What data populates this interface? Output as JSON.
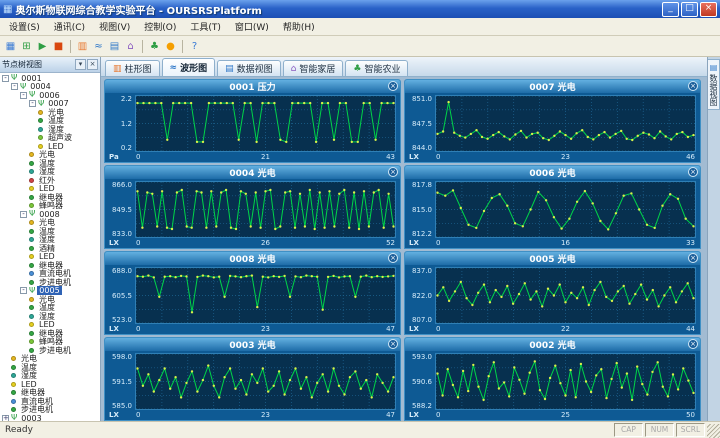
{
  "window": {
    "title": "奥尔斯物联网综合教学实验平台 - OURSRSPlatform",
    "icon": "▦",
    "buttons": {
      "min": "_",
      "max": "□",
      "close": "×"
    }
  },
  "menu": {
    "items": [
      {
        "name": "menu-settings",
        "label": "设置(S)"
      },
      {
        "name": "menu-comm",
        "label": "通讯(C)"
      },
      {
        "name": "menu-view",
        "label": "视图(V)"
      },
      {
        "name": "menu-control",
        "label": "控制(O)"
      },
      {
        "name": "menu-tools",
        "label": "工具(T)"
      },
      {
        "name": "menu-window",
        "label": "窗口(W)"
      },
      {
        "name": "menu-help",
        "label": "帮助(H)"
      }
    ]
  },
  "toolbar": {
    "icons": [
      {
        "name": "config-icon",
        "glyph": "▦",
        "color": "#3a7bd5"
      },
      {
        "name": "serial-connect-icon",
        "glyph": "⊞",
        "color": "#2f9e44"
      },
      {
        "name": "start-icon",
        "glyph": "▶",
        "color": "#2f9e44"
      },
      {
        "name": "stop-icon",
        "glyph": "■",
        "color": "#d9480f"
      },
      {
        "sep": true
      },
      {
        "name": "bar-chart-icon",
        "glyph": "▥",
        "color": "#e8762d"
      },
      {
        "name": "waveform-icon",
        "glyph": "≈",
        "color": "#2e77c8"
      },
      {
        "name": "data-table-icon",
        "glyph": "▤",
        "color": "#2e77c8"
      },
      {
        "name": "smart-home-icon",
        "glyph": "⌂",
        "color": "#8a5ac0"
      },
      {
        "sep": true
      },
      {
        "name": "smart-agriculture-icon",
        "glyph": "♣",
        "color": "#2f9e44"
      },
      {
        "name": "node-manager-icon",
        "glyph": "●",
        "color": "#f59f00"
      },
      {
        "sep": true
      },
      {
        "name": "help-icon",
        "glyph": "?",
        "color": "#3a7bd5"
      }
    ]
  },
  "sidebar": {
    "title": "节点树视图",
    "buttons": [
      "▾",
      "×"
    ],
    "tree": [
      {
        "label": "0001",
        "depth": 0,
        "kind": "node",
        "expand": "-"
      },
      {
        "label": "0004",
        "depth": 1,
        "kind": "node",
        "expand": "-"
      },
      {
        "label": "0006",
        "depth": 2,
        "kind": "node",
        "expand": "-"
      },
      {
        "label": "0007",
        "depth": 3,
        "kind": "node",
        "expand": "-"
      },
      {
        "label": "光电",
        "depth": 4,
        "kind": "sensor",
        "color": "#e6b820"
      },
      {
        "label": "温度",
        "depth": 4,
        "kind": "sensor",
        "color": "#35a845"
      },
      {
        "label": "湿度",
        "depth": 4,
        "kind": "sensor",
        "color": "#2fa898"
      },
      {
        "label": "超声波",
        "depth": 4,
        "kind": "sensor",
        "color": "#7cc83a"
      },
      {
        "label": "LED",
        "depth": 4,
        "kind": "sensor",
        "color": "#e6d020"
      },
      {
        "label": "光电",
        "depth": 3,
        "kind": "sensor",
        "color": "#e6b820"
      },
      {
        "label": "温度",
        "depth": 3,
        "kind": "sensor",
        "color": "#35a845"
      },
      {
        "label": "湿度",
        "depth": 3,
        "kind": "sensor",
        "color": "#2fa898"
      },
      {
        "label": "红外",
        "depth": 3,
        "kind": "sensor",
        "color": "#d04545"
      },
      {
        "label": "LED",
        "depth": 3,
        "kind": "sensor",
        "color": "#e6d020"
      },
      {
        "label": "继电器",
        "depth": 3,
        "kind": "sensor",
        "color": "#35a845"
      },
      {
        "label": "蜂鸣器",
        "depth": 3,
        "kind": "sensor",
        "color": "#7cc83a"
      },
      {
        "label": "0008",
        "depth": 2,
        "kind": "node",
        "expand": "-"
      },
      {
        "label": "光电",
        "depth": 3,
        "kind": "sensor",
        "color": "#e6b820"
      },
      {
        "label": "温度",
        "depth": 3,
        "kind": "sensor",
        "color": "#35a845"
      },
      {
        "label": "湿度",
        "depth": 3,
        "kind": "sensor",
        "color": "#2fa898"
      },
      {
        "label": "酒精",
        "depth": 3,
        "kind": "sensor",
        "color": "#35a845"
      },
      {
        "label": "LED",
        "depth": 3,
        "kind": "sensor",
        "color": "#e6d020"
      },
      {
        "label": "继电器",
        "depth": 3,
        "kind": "sensor",
        "color": "#35a845"
      },
      {
        "label": "直流电机",
        "depth": 3,
        "kind": "sensor",
        "color": "#4a90d8"
      },
      {
        "label": "步进电机",
        "depth": 3,
        "kind": "sensor",
        "color": "#35a845"
      },
      {
        "label": "0005",
        "depth": 2,
        "kind": "node",
        "expand": "-",
        "selected": true
      },
      {
        "label": "光电",
        "depth": 3,
        "kind": "sensor",
        "color": "#e6b820"
      },
      {
        "label": "温度",
        "depth": 3,
        "kind": "sensor",
        "color": "#35a845"
      },
      {
        "label": "湿度",
        "depth": 3,
        "kind": "sensor",
        "color": "#2fa898"
      },
      {
        "label": "LED",
        "depth": 3,
        "kind": "sensor",
        "color": "#e6d020"
      },
      {
        "label": "继电器",
        "depth": 3,
        "kind": "sensor",
        "color": "#35a845"
      },
      {
        "label": "蜂鸣器",
        "depth": 3,
        "kind": "sensor",
        "color": "#7cc83a"
      },
      {
        "label": "步进电机",
        "depth": 3,
        "kind": "sensor",
        "color": "#35a845"
      },
      {
        "label": "光电",
        "depth": 1,
        "kind": "sensor",
        "color": "#e6b820"
      },
      {
        "label": "温度",
        "depth": 1,
        "kind": "sensor",
        "color": "#35a845"
      },
      {
        "label": "湿度",
        "depth": 1,
        "kind": "sensor",
        "color": "#2fa898"
      },
      {
        "label": "LED",
        "depth": 1,
        "kind": "sensor",
        "color": "#e6d020"
      },
      {
        "label": "继电器",
        "depth": 1,
        "kind": "sensor",
        "color": "#35a845"
      },
      {
        "label": "直流电机",
        "depth": 1,
        "kind": "sensor",
        "color": "#4a90d8"
      },
      {
        "label": "步进电机",
        "depth": 1,
        "kind": "sensor",
        "color": "#35a845"
      },
      {
        "label": "0003",
        "depth": 0,
        "kind": "node",
        "expand": "+"
      }
    ]
  },
  "tabs": [
    {
      "name": "tab-bar-chart",
      "icon_name": "bar-chart-icon",
      "label": "柱形图",
      "glyph": "▥",
      "color": "#e8762d",
      "active": false
    },
    {
      "name": "tab-waveform",
      "icon_name": "waveform-icon",
      "label": "波形图",
      "glyph": "≈",
      "color": "#2e77c8",
      "active": true
    },
    {
      "name": "tab-data-view",
      "icon_name": "data-table-icon",
      "label": "数据视图",
      "glyph": "▤",
      "color": "#2e77c8",
      "active": false
    },
    {
      "name": "tab-smart-home",
      "icon_name": "smart-home-icon",
      "label": "智能家居",
      "glyph": "⌂",
      "color": "#8a5ac0",
      "active": false
    },
    {
      "name": "tab-smart-agriculture",
      "icon_name": "smart-agriculture-icon",
      "label": "智能农业",
      "glyph": "♣",
      "color": "#2f9e44",
      "active": false
    }
  ],
  "right_tab": {
    "icon": "▤",
    "label": "数据视图"
  },
  "status": {
    "left": "Ready",
    "cells": [
      "CAP",
      "NUM",
      "SCRL"
    ]
  },
  "chart_style": {
    "line": "#00d448",
    "marker": "#d8f04a",
    "plot_bg": "#07304f",
    "grid": "#1e6593",
    "panel_bg": "#0e5a94",
    "panel_close_glyph": "×"
  },
  "chart_data": [
    {
      "type": "line",
      "title": "0001 压力",
      "unit": "Pa",
      "y_labels": [
        "2.2",
        "1.2",
        "0.2"
      ],
      "ylim": [
        0,
        2.4
      ],
      "x_ticks": [
        "0",
        "21",
        "43"
      ],
      "values": [
        2.2,
        2.2,
        2.2,
        2.2,
        2.2,
        0.4,
        2.2,
        2.2,
        2.2,
        2.2,
        0.3,
        0.3,
        2.2,
        2.2,
        2.2,
        2.2,
        2.2,
        0.4,
        2.2,
        2.2,
        0.3,
        2.2,
        2.2,
        2.2,
        0.4,
        0.3,
        2.2,
        2.2,
        2.2,
        2.2,
        0.3,
        2.2,
        2.2,
        0.4,
        2.2,
        2.2,
        0.3,
        0.3,
        2.2,
        2.2,
        0.4,
        2.2,
        2.2,
        2.2
      ]
    },
    {
      "type": "line",
      "title": "0007 光电",
      "unit": "LX",
      "y_labels": [
        "851.0",
        "847.5",
        "844.0"
      ],
      "ylim": [
        843.5,
        851.5
      ],
      "x_ticks": [
        "0",
        "23",
        "46"
      ],
      "values": [
        845.8,
        846.2,
        851.0,
        846.0,
        845.5,
        845.2,
        845.8,
        846.4,
        845.3,
        845.0,
        845.6,
        846.1,
        845.4,
        844.9,
        845.7,
        846.3,
        845.2,
        845.8,
        846.0,
        845.1,
        844.8,
        845.5,
        846.2,
        845.6,
        845.0,
        845.9,
        846.4,
        845.3,
        844.9,
        845.6,
        846.1,
        845.2,
        845.8,
        846.3,
        845.0,
        844.8,
        845.5,
        846.0,
        845.7,
        845.1,
        846.2,
        845.4,
        844.9,
        845.8,
        846.1,
        845.3,
        845.6
      ]
    },
    {
      "type": "line",
      "title": "0004 光电",
      "unit": "LX",
      "y_labels": [
        "866.0",
        "849.5",
        "833.0"
      ],
      "ylim": [
        830,
        869
      ],
      "x_ticks": [
        "0",
        "26",
        "52"
      ],
      "values": [
        864,
        835,
        863,
        862,
        836,
        864,
        835,
        834,
        863,
        865,
        836,
        835,
        864,
        863,
        835,
        864,
        836,
        863,
        865,
        835,
        834,
        864,
        862,
        836,
        863,
        835,
        864,
        865,
        834,
        836,
        863,
        864,
        835,
        862,
        836,
        865,
        834,
        863,
        835,
        864,
        836,
        862,
        865,
        835,
        863,
        834,
        864,
        836,
        863,
        865,
        835,
        862,
        836
      ]
    },
    {
      "type": "line",
      "title": "0006 光电",
      "unit": "LX",
      "y_labels": [
        "817.8",
        "815.0",
        "812.2"
      ],
      "ylim": [
        811.8,
        818.2
      ],
      "x_ticks": [
        "0",
        "16",
        "33"
      ],
      "values": [
        817.2,
        816.8,
        817.5,
        815.2,
        813.0,
        812.6,
        814.8,
        816.5,
        817.0,
        815.5,
        813.2,
        812.8,
        815.0,
        817.3,
        816.2,
        814.0,
        812.5,
        813.8,
        816.0,
        817.4,
        815.8,
        813.5,
        812.4,
        814.5,
        816.8,
        817.1,
        815.0,
        813.0,
        812.6,
        815.5,
        817.0,
        816.4,
        813.8,
        812.8
      ]
    },
    {
      "type": "line",
      "title": "0008 光电",
      "unit": "LX",
      "y_labels": [
        "688.0",
        "605.5",
        "523.0"
      ],
      "ylim": [
        510,
        700
      ],
      "x_ticks": [
        "0",
        "23",
        "47"
      ],
      "values": [
        680,
        678,
        682,
        675,
        600,
        678,
        680,
        676,
        681,
        679,
        540,
        677,
        682,
        680,
        675,
        678,
        600,
        681,
        679,
        676,
        680,
        682,
        560,
        678,
        675,
        680,
        677,
        681,
        600,
        679,
        676,
        682,
        680,
        678,
        550,
        677,
        681,
        675,
        679,
        680,
        600,
        678,
        682,
        676,
        680,
        677,
        679,
        681
      ]
    },
    {
      "type": "line",
      "title": "0005 光电",
      "unit": "LX",
      "y_labels": [
        "837.0",
        "822.0",
        "807.0"
      ],
      "ylim": [
        804,
        840
      ],
      "x_ticks": [
        "0",
        "22",
        "44"
      ],
      "values": [
        822,
        828,
        818,
        825,
        832,
        820,
        815,
        824,
        830,
        817,
        826,
        821,
        829,
        816,
        823,
        831,
        819,
        825,
        814,
        827,
        822,
        830,
        817,
        824,
        820,
        828,
        815,
        826,
        832,
        821,
        818,
        825,
        829,
        816,
        823,
        830,
        819,
        826,
        814,
        822,
        828,
        817,
        825,
        831,
        820
      ]
    },
    {
      "type": "line",
      "title": "0003 光电",
      "unit": "LX",
      "y_labels": [
        "598.0",
        "591.5",
        "585.0"
      ],
      "ylim": [
        583,
        600
      ],
      "x_ticks": [
        "0",
        "23",
        "47"
      ],
      "values": [
        596,
        590,
        594,
        588,
        592,
        596,
        589,
        593,
        586,
        591,
        595,
        588,
        592,
        597,
        590,
        586,
        593,
        596,
        589,
        592,
        587,
        594,
        591,
        596,
        588,
        590,
        595,
        587,
        592,
        596,
        589,
        593,
        586,
        591,
        594,
        588,
        596,
        590,
        587,
        593,
        595,
        589,
        592,
        586,
        594,
        591,
        588,
        593
      ]
    },
    {
      "type": "line",
      "title": "0002 光电",
      "unit": "LX",
      "y_labels": [
        "593.0",
        "590.6",
        "588.2"
      ],
      "ylim": [
        587.8,
        593.4
      ],
      "x_ticks": [
        "0",
        "25",
        "50"
      ],
      "values": [
        591.5,
        589.0,
        592.0,
        590.2,
        588.8,
        591.8,
        589.5,
        592.5,
        590.0,
        588.5,
        591.2,
        592.8,
        589.8,
        590.5,
        588.9,
        592.2,
        590.8,
        589.2,
        591.6,
        592.9,
        589.6,
        588.6,
        591.0,
        592.4,
        590.4,
        589.0,
        591.9,
        588.8,
        592.6,
        590.6,
        589.4,
        591.3,
        592.0,
        588.7,
        590.9,
        592.7,
        589.9,
        591.5,
        588.5,
        592.3,
        590.3,
        589.1,
        591.7,
        592.8,
        590.0,
        588.9,
        591.4,
        589.7,
        592.1,
        590.7,
        589.3
      ]
    }
  ]
}
